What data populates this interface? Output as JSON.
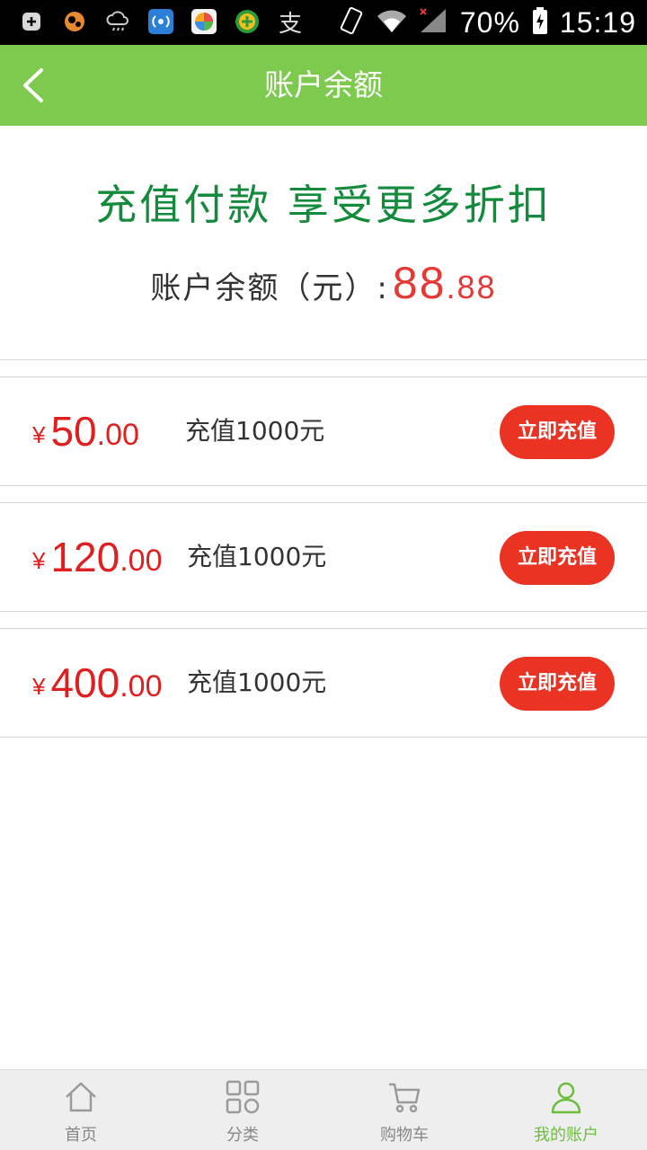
{
  "status_bar": {
    "battery": "70%",
    "time": "15:19",
    "icons": [
      "plus-square-icon",
      "uc-browser-icon",
      "cloud-rain-icon",
      "wifi-hotspot-icon",
      "colorful-app-icon",
      "plus-circle-icon",
      "alipay-icon",
      "vibrate-icon",
      "wifi-icon",
      "signal-icon",
      "battery-icon"
    ]
  },
  "header": {
    "title": "账户余额",
    "back_icon": "chevron-left-icon"
  },
  "promo": {
    "title": "充值付款 享受更多折扣",
    "balance_label": "账户余额（元）:",
    "balance_int": "88",
    "balance_dec": ".88"
  },
  "options": [
    {
      "currency": "¥",
      "price_int": "50",
      "price_dec": ".00",
      "desc": "充值1000元",
      "button": "立即充值"
    },
    {
      "currency": "¥",
      "price_int": "120",
      "price_dec": ".00",
      "desc": "充值1000元",
      "button": "立即充值"
    },
    {
      "currency": "¥",
      "price_int": "400",
      "price_dec": ".00",
      "desc": "充值1000元",
      "button": "立即充值"
    }
  ],
  "nav": {
    "items": [
      {
        "label": "首页",
        "icon": "home-icon",
        "active": false
      },
      {
        "label": "分类",
        "icon": "grid-icon",
        "active": false
      },
      {
        "label": "购物车",
        "icon": "cart-icon",
        "active": false
      },
      {
        "label": "我的账户",
        "icon": "user-icon",
        "active": true
      }
    ]
  },
  "colors": {
    "header_green": "#7dca4f",
    "promo_green": "#138a3c",
    "price_red": "#e02020",
    "button_red": "#ea3323",
    "nav_active": "#6cbf3c"
  }
}
